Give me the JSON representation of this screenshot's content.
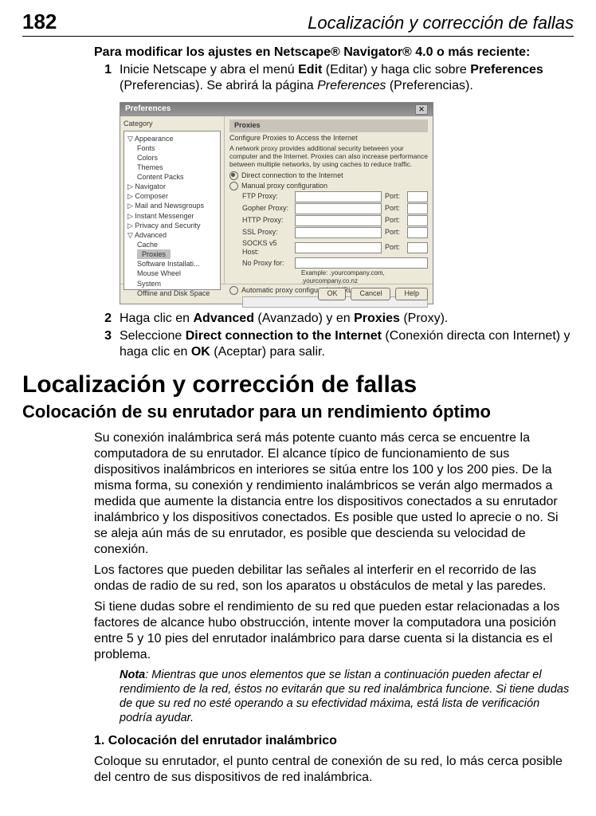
{
  "page_number": "182",
  "running_title": "Localización y corrección de fallas",
  "intro_bold": "Para modificar los ajustes en Netscape® Navigator® 4.0 o más reciente:",
  "steps": [
    {
      "num": "1",
      "pre": "Inicie Netscape y abra el menú ",
      "b1": "Edit",
      "mid1": " (Editar) y haga clic sobre ",
      "b2": "Preferences",
      "mid2": " (Preferencias). Se abrirá la página ",
      "i1": "Preferences",
      "end": " (Preferencias)."
    },
    {
      "num": "2",
      "pre": "Haga clic en ",
      "b1": "Advanced",
      "mid1": " (Avanzado) y en ",
      "b2": "Proxies",
      "mid2": " (Proxy).",
      "i1": "",
      "end": ""
    },
    {
      "num": "3",
      "pre": "Seleccione ",
      "b1": "Direct connection to the Internet",
      "mid1": " (Conexión directa con Internet) y haga clic en ",
      "b2": "OK",
      "mid2": " (Aceptar) para salir.",
      "i1": "",
      "end": ""
    }
  ],
  "dialog": {
    "title": "Preferences",
    "category_label": "Category",
    "tree": {
      "appearance": "Appearance",
      "fonts": "Fonts",
      "colors": "Colors",
      "themes": "Themes",
      "content_packs": "Content Packs",
      "navigator": "Navigator",
      "composer": "Composer",
      "mail": "Mail and Newsgroups",
      "im": "Instant Messenger",
      "privacy": "Privacy and Security",
      "advanced": "Advanced",
      "cache": "Cache",
      "proxies": "Proxies",
      "software": "Software Installati...",
      "mouse": "Mouse Wheel",
      "system": "System",
      "offline": "Offline and Disk Space"
    },
    "panel_title": "Proxies",
    "panel_sub": "Configure Proxies to Access the Internet",
    "panel_desc": "A network proxy provides additional security between your computer and the Internet. Proxies can also increase performance between multiple networks, by using caches to reduce traffic.",
    "radio_direct": "Direct connection to the Internet",
    "radio_manual": "Manual proxy configuration",
    "rows": [
      {
        "label": "FTP Proxy:",
        "port": "Port:"
      },
      {
        "label": "Gopher Proxy:",
        "port": "Port:"
      },
      {
        "label": "HTTP Proxy:",
        "port": "Port:"
      },
      {
        "label": "SSL Proxy:",
        "port": "Port:"
      },
      {
        "label": "SOCKS v5 Host:",
        "port": "Port:"
      }
    ],
    "no_proxy": "No Proxy for:",
    "example": "Example: .yourcompany.com, .yourcompany.co.nz",
    "radio_auto": "Automatic proxy configuration URL:",
    "btn_ok": "OK",
    "btn_cancel": "Cancel",
    "btn_help": "Help"
  },
  "h1": "Localización y corrección de fallas",
  "h2": "Colocación de su enrutador para un rendimiento óptimo",
  "para1": "Su conexión inalámbrica será más potente cuanto más cerca se encuentre la computadora de su enrutador. El alcance típico de funcionamiento de sus dispositivos inalámbricos en interiores se sitúa entre los 100 y los 200 pies. De la misma forma, su conexión y rendimiento inalámbricos se verán algo mermados a medida que aumente la distancia entre los dispositivos conectados a su enrutador inalámbrico y los dispositivos conectados. Es posible que usted lo aprecie o no. Si se aleja aún más de su enrutador, es posible que descienda su velocidad de conexión.",
  "para2": "Los factores que pueden debilitar las señales al interferir en el recorrido de las ondas de radio de su red, son los aparatos u obstáculos de metal y las paredes.",
  "para3": "Si tiene dudas sobre el rendimiento de su red que pueden estar relacionadas a los factores de alcance hubo obstrucción, intente mover la computadora una posición entre 5 y 10 pies del enrutador inalámbrico para darse cuenta si la distancia es el problema.",
  "note_label": "Nota",
  "note_text": ": Mientras que unos elementos que se listan a continuación pueden afectar el rendimiento de la red, éstos no evitarán que su red inalámbrica funcione. Si tiene dudas de que su red no esté operando a su efectividad máxima, está lista de verificación podría ayudar.",
  "sub1_title": "1. Colocación del enrutador inalámbrico",
  "sub1_text": "Coloque su enrutador, el punto central de conexión de su red, lo más cerca posible del centro de sus dispositivos de red inalámbrica."
}
